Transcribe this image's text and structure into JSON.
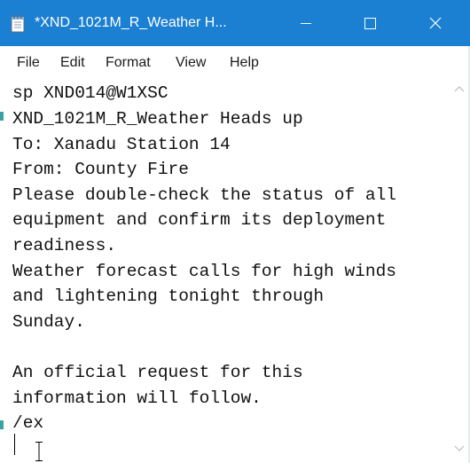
{
  "window": {
    "title": "*XND_1021M_R_Weather H...",
    "title_bar_color": "#1b7fd2"
  },
  "title_buttons": {
    "minimize_icon": "minimize-icon",
    "maximize_icon": "maximize-icon",
    "close_icon": "close-icon"
  },
  "menu": {
    "file": "File",
    "edit": "Edit",
    "format": "Format",
    "view": "View",
    "help": "Help"
  },
  "editor": {
    "lines": [
      "sp XND014@W1XSC",
      "XND_1021M_R_Weather Heads up",
      "To: Xanadu Station 14",
      "From: County Fire",
      "Please double-check the status of all",
      "equipment and confirm its deployment",
      "readiness.",
      "Weather forecast calls for high winds",
      "and lightening tonight through",
      "Sunday.",
      "",
      "An official request for this",
      "information will follow.",
      "/ex"
    ]
  }
}
